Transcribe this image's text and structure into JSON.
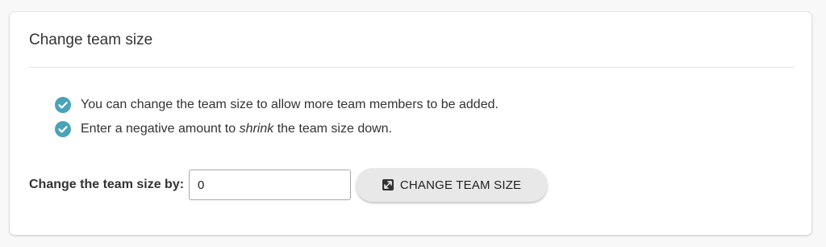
{
  "card": {
    "title": "Change team size"
  },
  "bullets": [
    {
      "icon": "check-circle-icon",
      "text_before": "You can change the team size to allow more team members to be added.",
      "emphasis": "",
      "text_after": ""
    },
    {
      "icon": "check-circle-icon",
      "text_before": "Enter a negative amount to ",
      "emphasis": "shrink",
      "text_after": " the team size down."
    }
  ],
  "form": {
    "label": "Change the team size by:",
    "input_value": "0",
    "button_label": "CHANGE TEAM SIZE",
    "button_icon": "resize-icon"
  },
  "colors": {
    "check": "#4aa3b8",
    "button_bg": "#e8e8e8"
  }
}
